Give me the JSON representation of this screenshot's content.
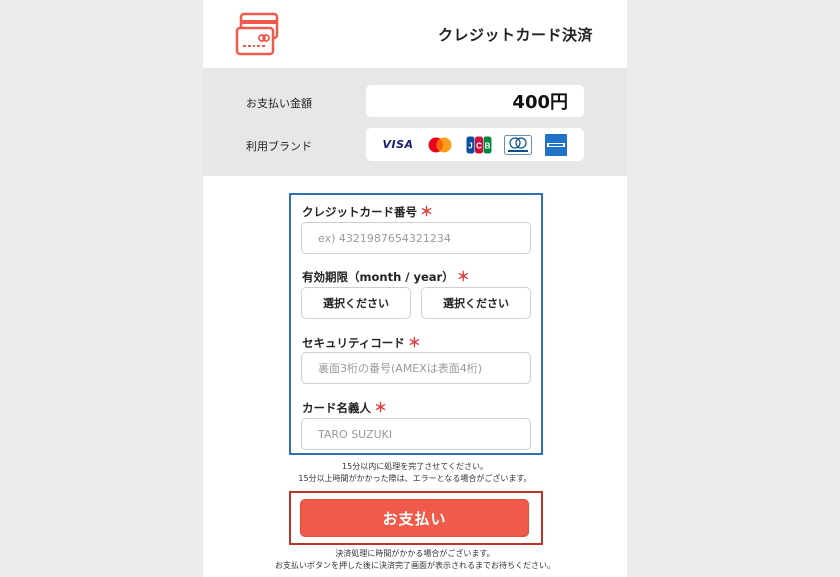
{
  "header": {
    "title": "クレジットカード決済",
    "icon": "credit-card-icon"
  },
  "summary": {
    "amount_label": "お支払い金額",
    "amount_value": "400円",
    "brands_label": "利用ブランド",
    "brands": [
      "VISA",
      "Mastercard",
      "JCB",
      "Diners Club",
      "American Express"
    ]
  },
  "form": {
    "card_number": {
      "label": "クレジットカード番号",
      "required_mark": "＊",
      "placeholder": "ex) 4321987654321234"
    },
    "expiry": {
      "label": "有効期限（month / year）",
      "required_mark": "＊",
      "month_select": "選択ください",
      "year_select": "選択ください"
    },
    "security_code": {
      "label": "セキュリティコード",
      "required_mark": "＊",
      "placeholder": "裏面3桁の番号(AMEXは表面4桁)"
    },
    "card_holder": {
      "label": "カード名義人",
      "required_mark": "＊",
      "placeholder": "TARO SUZUKI"
    }
  },
  "notes": {
    "time_limit_1": "15分以内に処理を完了させてください。",
    "time_limit_2": "15分以上時間がかかった際は、エラーとなる場合がございます。",
    "processing_1": "決済処理に時間がかかる場合がございます。",
    "processing_2": "お支払いボタンを押した後に決済完了画面が表示されるまでお待ちください。"
  },
  "pay_button": {
    "label": "お支払い"
  },
  "colors": {
    "accent": "#ef5a4a",
    "form_highlight": "#2f6fb4",
    "button_highlight": "#c0332a",
    "required": "#e53935"
  }
}
